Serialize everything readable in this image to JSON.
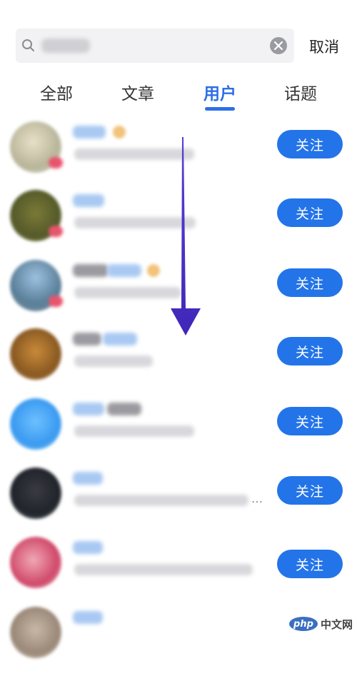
{
  "search": {
    "cancel_label": "取消"
  },
  "tabs": [
    {
      "label": "全部"
    },
    {
      "label": "文章"
    },
    {
      "label": "用户",
      "active": true
    },
    {
      "label": "话题"
    }
  ],
  "users": [
    {
      "follow_label": "关注"
    },
    {
      "follow_label": "关注"
    },
    {
      "follow_label": "关注"
    },
    {
      "follow_label": "关注"
    },
    {
      "follow_label": "关注"
    },
    {
      "follow_label": "关注"
    },
    {
      "follow_label": "关注"
    },
    {}
  ],
  "watermark": {
    "badge": "php",
    "text": "中文网"
  },
  "colors": {
    "accent": "#2374e8",
    "arrow": "#4a2fc4"
  }
}
